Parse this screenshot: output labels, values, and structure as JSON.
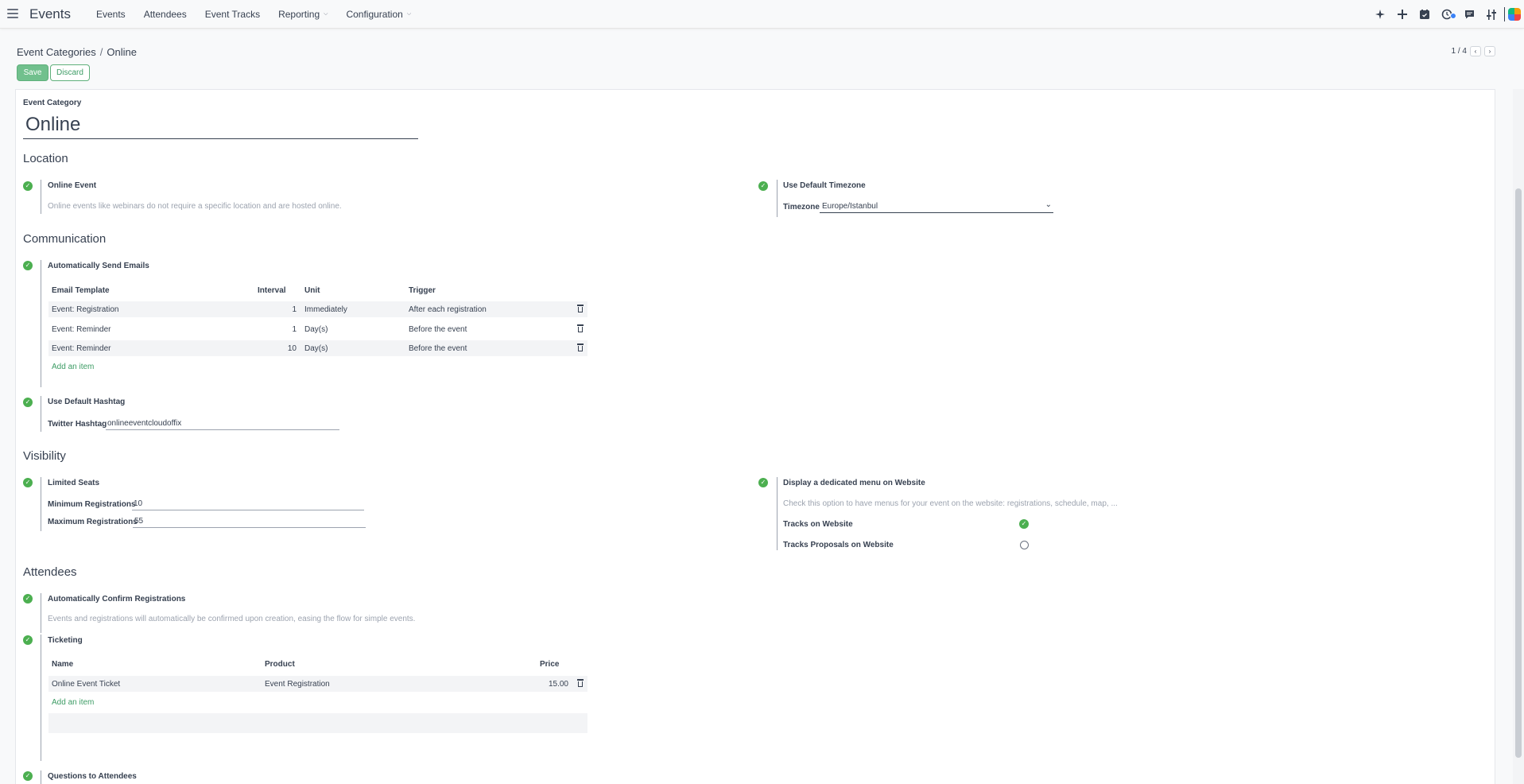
{
  "app": {
    "title": "Events"
  },
  "nav": {
    "items": [
      {
        "label": "Events",
        "dropdown": false
      },
      {
        "label": "Attendees",
        "dropdown": false
      },
      {
        "label": "Event Tracks",
        "dropdown": false
      },
      {
        "label": "Reporting",
        "dropdown": true
      },
      {
        "label": "Configuration",
        "dropdown": true
      }
    ]
  },
  "systray": {
    "icons": [
      "sparkle-icon",
      "plus-icon",
      "calendar-check-icon",
      "clock-activity-icon",
      "chat-icon",
      "settings-sliders-icon"
    ]
  },
  "breadcrumb": {
    "parent": "Event Categories",
    "current": "Online"
  },
  "buttons": {
    "save": "Save",
    "discard": "Discard"
  },
  "pager": {
    "value": "1 / 4"
  },
  "form": {
    "name_label": "Event Category",
    "name_value": "Online",
    "location": {
      "title": "Location",
      "online_event": {
        "label": "Online Event",
        "checked": true,
        "help": "Online events like webinars do not require a specific location and are hosted online."
      },
      "default_timezone": {
        "label": "Use Default Timezone",
        "checked": true,
        "field_label": "Timezone",
        "value": "Europe/Istanbul"
      }
    },
    "communication": {
      "title": "Communication",
      "auto_emails": {
        "label": "Automatically Send Emails",
        "checked": true
      },
      "mail_table": {
        "headers": {
          "template": "Email Template",
          "interval": "Interval",
          "unit": "Unit",
          "trigger": "Trigger"
        },
        "rows": [
          {
            "template": "Event: Registration",
            "interval": "1",
            "unit": "Immediately",
            "trigger": "After each registration"
          },
          {
            "template": "Event: Reminder",
            "interval": "1",
            "unit": "Day(s)",
            "trigger": "Before the event"
          },
          {
            "template": "Event: Reminder",
            "interval": "10",
            "unit": "Day(s)",
            "trigger": "Before the event"
          }
        ],
        "add_item": "Add an item"
      },
      "default_hashtag": {
        "label": "Use Default Hashtag",
        "checked": true,
        "field_label": "Twitter Hashtag",
        "value": "onlineeventcloudoffix"
      }
    },
    "visibility": {
      "title": "Visibility",
      "limited_seats": {
        "label": "Limited Seats",
        "checked": true,
        "min_label": "Minimum Registrations",
        "min_value": "10",
        "max_label": "Maximum Registrations",
        "max_value": "55"
      },
      "website_menu": {
        "label": "Display a dedicated menu on Website",
        "checked": true,
        "help": "Check this option to have menus for your event on the website: registrations, schedule, map, ...",
        "tracks_label": "Tracks on Website",
        "tracks_checked": true,
        "proposals_label": "Tracks Proposals on Website",
        "proposals_checked": false
      }
    },
    "attendees": {
      "title": "Attendees",
      "auto_confirm": {
        "label": "Automatically Confirm Registrations",
        "checked": true,
        "help": "Events and registrations will automatically be confirmed upon creation, easing the flow for simple events."
      },
      "ticketing": {
        "label": "Ticketing",
        "checked": true,
        "headers": {
          "name": "Name",
          "product": "Product",
          "price": "Price"
        },
        "rows": [
          {
            "name": "Online Event Ticket",
            "product": "Event Registration",
            "price": "15.00"
          }
        ],
        "add_item": "Add an item"
      },
      "questions": {
        "label": "Questions to Attendees",
        "checked": true
      }
    }
  }
}
